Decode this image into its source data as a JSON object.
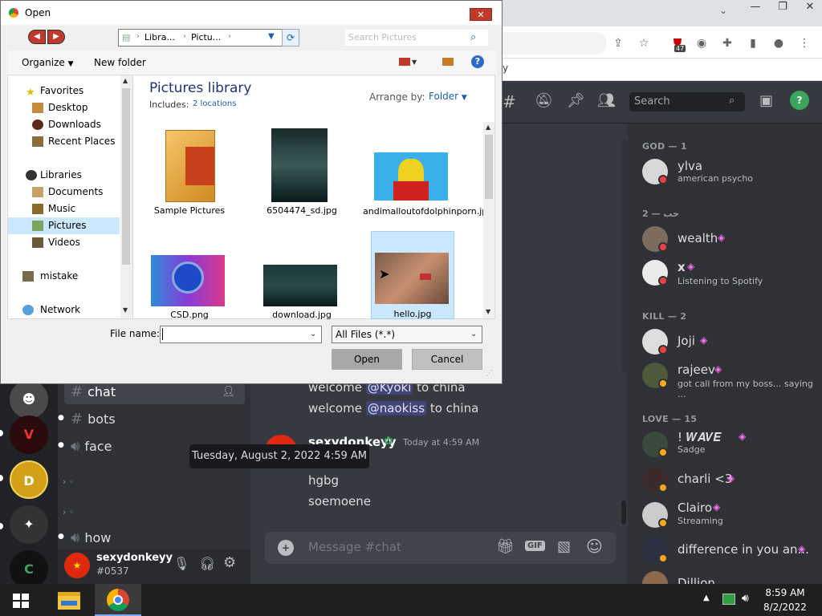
{
  "dialog": {
    "title": "Open",
    "breadcrumb": [
      "Libra...",
      "Pictu..."
    ],
    "search_placeholder": "Search Pictures",
    "organize_label": "Organize",
    "new_folder_label": "New folder",
    "nav": {
      "favorites": "Favorites",
      "desktop": "Desktop",
      "downloads": "Downloads",
      "recent": "Recent Places",
      "libraries": "Libraries",
      "documents": "Documents",
      "music": "Music",
      "pictures": "Pictures",
      "videos": "Videos",
      "mistake": "mistake",
      "network": "Network"
    },
    "library_title": "Pictures library",
    "includes_label": "Includes:",
    "includes_link": "2 locations",
    "arrange_label": "Arrange by:",
    "arrange_value": "Folder",
    "files": [
      {
        "name": "Sample Pictures"
      },
      {
        "name": "6504474_sd.jpg"
      },
      {
        "name": "andimalloutofdolphinporn.jpg"
      },
      {
        "name": "CSD.png"
      },
      {
        "name": "download.jpg"
      },
      {
        "name": "hello.jpg"
      }
    ],
    "filename_label": "File name:",
    "filename_value": "",
    "filetype_value": "All Files (*.*)",
    "open_label": "Open",
    "cancel_label": "Cancel"
  },
  "discord": {
    "search_placeholder": "Search",
    "channels": [
      {
        "name": "chat"
      },
      {
        "name": "bots"
      },
      {
        "name": "face"
      },
      {
        "name": "how"
      }
    ],
    "user": {
      "name": "sexydonkeyy",
      "tag": "#0537"
    },
    "messages": {
      "welcome1_pre": "welcome ",
      "welcome1_mention": "@Kyoki",
      "welcome1_post": " to china",
      "welcome2_pre": "welcome ",
      "welcome2_mention": "@naokiss",
      "welcome2_post": " to china",
      "author": "sexydonkeyy",
      "timestamp": "Today at 4:59 AM",
      "line1": "hgbg",
      "line2": "soemoene"
    },
    "tooltip": "Tuesday, August 2, 2022 4:59 AM",
    "composer_placeholder": "Message #chat",
    "gif_label": "GIF",
    "member_groups": [
      {
        "title": "GOD — 1",
        "members": [
          {
            "name": "ylva",
            "sub": "american psycho"
          }
        ]
      },
      {
        "title": "2 — حب",
        "members": [
          {
            "name": "wealth",
            "sub": ""
          },
          {
            "name": "x",
            "sub": "Listening to Spotify"
          }
        ]
      },
      {
        "title": "KILL — 2",
        "members": [
          {
            "name": "Joji",
            "sub": ""
          },
          {
            "name": "rajeev",
            "sub": "got call from my boss... saying ..."
          }
        ]
      },
      {
        "title": "LOVE — 15",
        "members": [
          {
            "name": "! 𝑾𝑨𝑽𝑬",
            "sub": "Sadge"
          },
          {
            "name": "charli <3",
            "sub": ""
          },
          {
            "name": "Clairo",
            "sub": "Streaming"
          },
          {
            "name": "difference in you an...",
            "sub": ""
          },
          {
            "name": "Dillion",
            "sub": ""
          }
        ]
      }
    ]
  },
  "chrome": {
    "partial_text": "y",
    "badge_count": "47"
  },
  "taskbar": {
    "time": "8:59 AM",
    "date": "8/2/2022"
  }
}
